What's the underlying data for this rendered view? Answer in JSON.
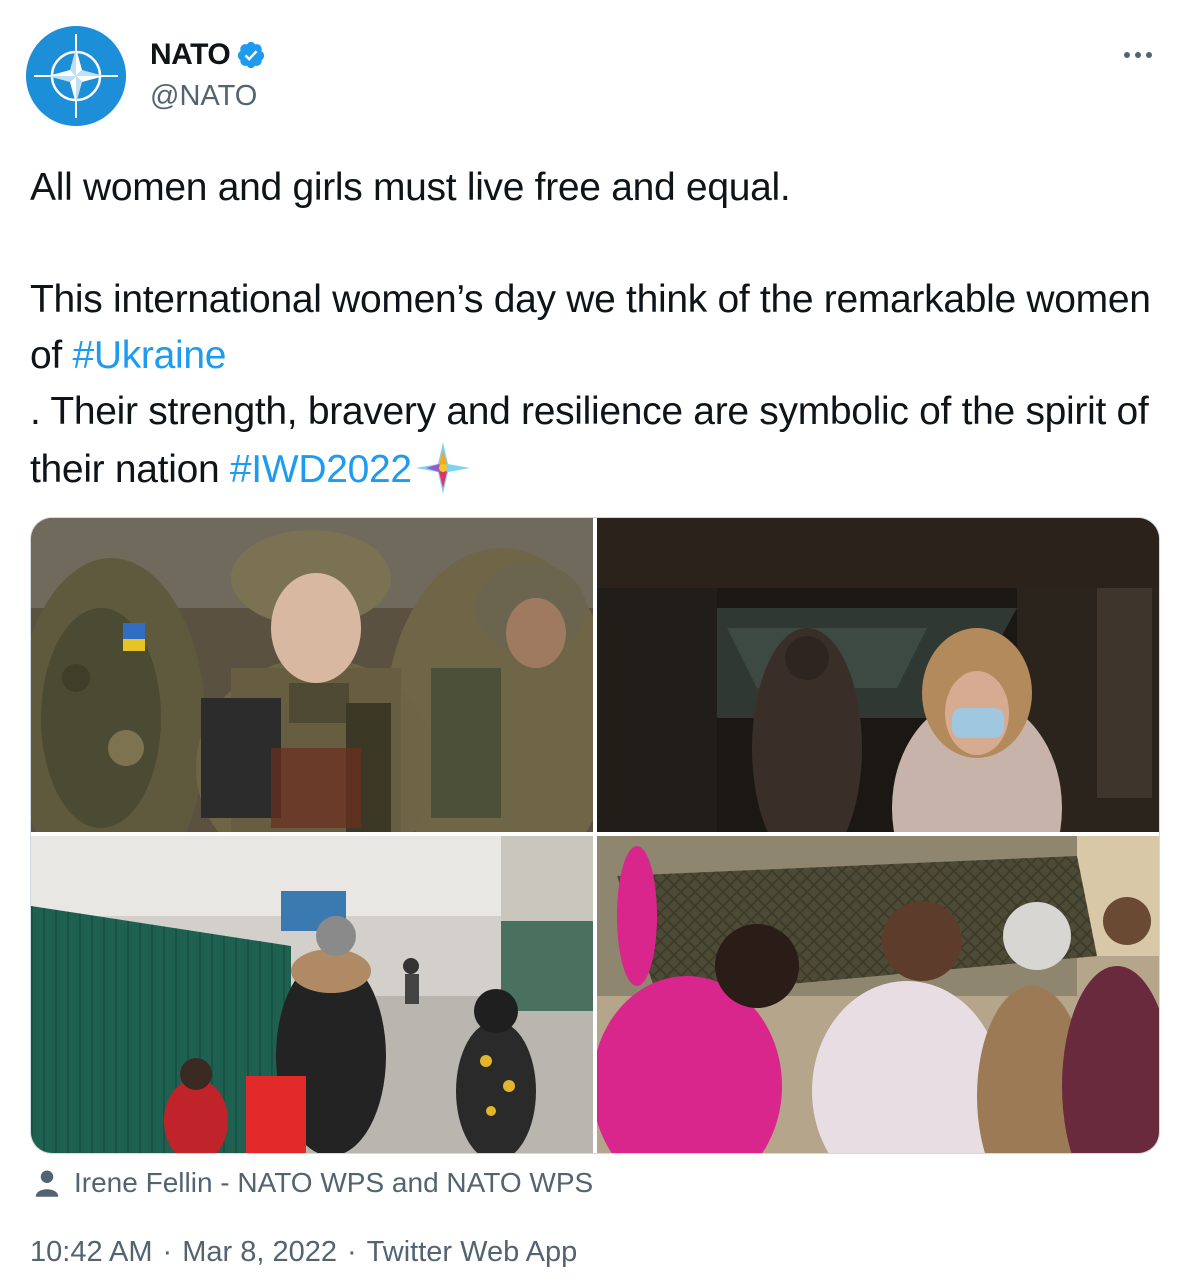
{
  "author": {
    "display_name": "NATO",
    "handle": "@NATO",
    "verified": true,
    "avatar_icon": "nato-compass-star-icon"
  },
  "tweet": {
    "line1": "All women and girls must live free and equal.",
    "line2_a": "This international women’s day we think of the remarkable women of ",
    "hashtag_1": "#Ukraine",
    "line2_b": ". Their strength, bravery and resilience are symbolic of the spirit of their nation ",
    "hashtag_2": "#IWD2022",
    "flag_emoji": "ukraine-flag-icon",
    "hashtag_emoji": "iwd-sparkle-icon"
  },
  "media": {
    "photos": [
      "photo-female-soldier",
      "photo-medical-worker-corridor",
      "photo-family-at-border",
      "photo-women-weaving-camouflage"
    ]
  },
  "tagged": {
    "icon": "person-icon",
    "text": "Irene Fellin - NATO WPS and NATO WPS"
  },
  "meta": {
    "time": "10:42 AM",
    "sep1": "·",
    "date": "Mar 8, 2022",
    "sep2": "·",
    "source": "Twitter Web App"
  },
  "colors": {
    "text": "#0f1419",
    "secondary": "#536471",
    "link": "#1d9bf0",
    "nato_blue": "#1d8fd8"
  }
}
